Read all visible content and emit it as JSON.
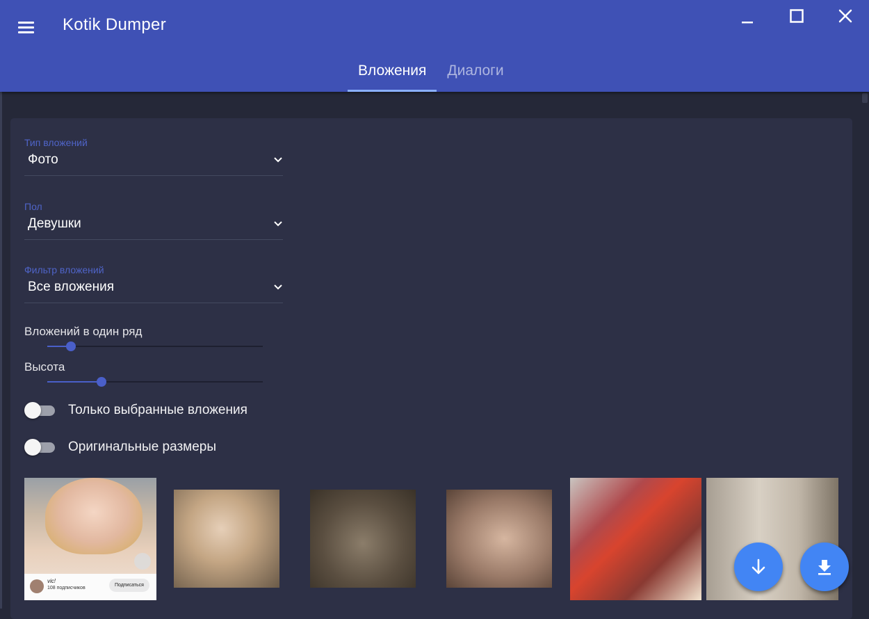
{
  "window": {
    "title": "Kotik Dumper"
  },
  "tabs": [
    {
      "label": "Вложения",
      "active": true
    },
    {
      "label": "Диалоги",
      "active": false
    }
  ],
  "filters": {
    "attachment_type": {
      "label": "Тип вложений",
      "value": "Фото"
    },
    "gender": {
      "label": "Пол",
      "value": "Девушки"
    },
    "attachment_filter": {
      "label": "Фильтр вложений",
      "value": "Все вложения"
    }
  },
  "sliders": {
    "per_row": {
      "label": "Вложений в один ряд",
      "fraction": 0.11
    },
    "height": {
      "label": "Высота",
      "fraction": 0.25
    }
  },
  "toggles": {
    "only_selected": {
      "label": "Только выбранные вложения",
      "on": false
    },
    "original_sizes": {
      "label": "Оригинальные размеры",
      "on": false
    }
  },
  "thumbnails": {
    "first_caption": {
      "name": "vic!",
      "subscribers": "108 подписчиков",
      "subscribe_button": "Подписаться"
    }
  },
  "colors": {
    "appbar": "#3f51b5",
    "background": "#252838",
    "card": "#2d3046",
    "accent": "#4a5fc9",
    "fab": "#4285f4"
  },
  "icons": {
    "menu": "menu-icon",
    "minimize": "minimize-icon",
    "maximize": "maximize-icon",
    "close": "close-icon",
    "fab_scroll": "arrow-down-icon",
    "fab_download": "download-icon"
  }
}
